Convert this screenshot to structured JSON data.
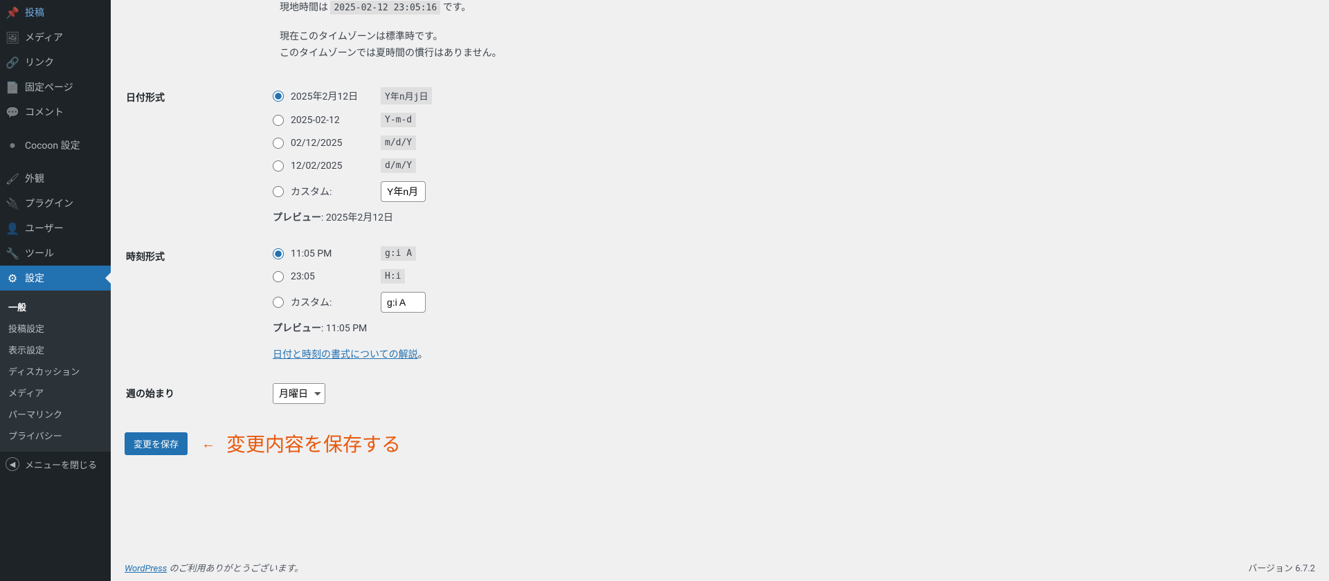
{
  "sidebar": {
    "items": [
      {
        "icon": "pin",
        "label": "投稿"
      },
      {
        "icon": "media",
        "label": "メディア"
      },
      {
        "icon": "link",
        "label": "リンク"
      },
      {
        "icon": "page",
        "label": "固定ページ"
      },
      {
        "icon": "comment",
        "label": "コメント"
      },
      {
        "icon": "dot",
        "label": "Cocoon 設定"
      },
      {
        "icon": "brush",
        "label": "外観"
      },
      {
        "icon": "plugin",
        "label": "プラグイン"
      },
      {
        "icon": "user",
        "label": "ユーザー"
      },
      {
        "icon": "tool",
        "label": "ツール"
      },
      {
        "icon": "settings",
        "label": "設定"
      }
    ],
    "submenu": [
      "一般",
      "投稿設定",
      "表示設定",
      "ディスカッション",
      "メディア",
      "パーマリンク",
      "プライバシー"
    ],
    "collapse": "メニューを閉じる"
  },
  "timezone": {
    "local_prefix": "現地時間は",
    "local_value": "2025-02-12 23:05:16",
    "local_suffix": "です。",
    "std": "現在このタイムゾーンは標準時です。",
    "dst": "このタイムゾーンでは夏時間の慣行はありません。"
  },
  "date_format": {
    "heading": "日付形式",
    "options": [
      {
        "label": "2025年2月12日",
        "code": "Y年n月j日",
        "checked": true
      },
      {
        "label": "2025-02-12",
        "code": "Y-m-d"
      },
      {
        "label": "02/12/2025",
        "code": "m/d/Y"
      },
      {
        "label": "12/02/2025",
        "code": "d/m/Y"
      }
    ],
    "custom_label": "カスタム:",
    "custom_value": "Y年n月",
    "preview_label": "プレビュー",
    "preview_value": "2025年2月12日"
  },
  "time_format": {
    "heading": "時刻形式",
    "options": [
      {
        "label": "11:05 PM",
        "code": "g:i A",
        "checked": true
      },
      {
        "label": "23:05",
        "code": "H:i"
      }
    ],
    "custom_label": "カスタム:",
    "custom_value": "g:i A",
    "preview_label": "プレビュー",
    "preview_value": "11:05 PM",
    "doc_link": "日付と時刻の書式についての解説",
    "doc_suffix": "。"
  },
  "week": {
    "heading": "週の始まり",
    "value": "月曜日"
  },
  "submit": "変更を保存",
  "annotation": "変更内容を保存する",
  "footer": {
    "link": "WordPress",
    "text": " のご利用ありがとうございます。",
    "version": "バージョン 6.7.2"
  },
  "icons": {
    "pin": "📌",
    "media": "🖼",
    "link": "🔗",
    "page": "📄",
    "comment": "💬",
    "dot": "●",
    "brush": "🖌",
    "plugin": "🔌",
    "user": "👤",
    "tool": "🔧",
    "settings": "⚙",
    "collapse": "◀"
  }
}
